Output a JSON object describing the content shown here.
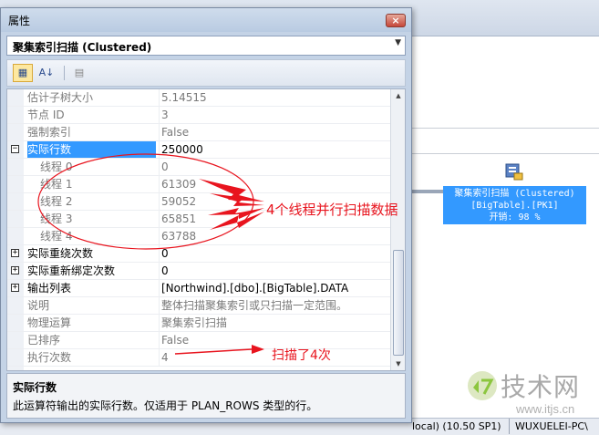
{
  "window": {
    "title": "属性",
    "close_label": "×",
    "object_selector": "聚集索引扫描 (Clustered)"
  },
  "toolbar": {
    "buttons": [
      {
        "name": "categorized-icon",
        "label": "▦"
      },
      {
        "name": "alphabetical-icon",
        "label": "A↓"
      },
      {
        "name": "property-pages-icon",
        "label": "▤"
      }
    ]
  },
  "properties": [
    {
      "name": "估计子树大小",
      "value": "5.14515",
      "readonly": true,
      "expander": "",
      "indent": false
    },
    {
      "name": "节点 ID",
      "value": "3",
      "readonly": true,
      "expander": "",
      "indent": false
    },
    {
      "name": "强制索引",
      "value": "False",
      "readonly": true,
      "expander": "",
      "indent": false
    },
    {
      "name": "实际行数",
      "value": "250000",
      "readonly": false,
      "expander": "−",
      "indent": false,
      "selected": true
    },
    {
      "name": "线程 0",
      "value": "0",
      "readonly": true,
      "expander": "",
      "indent": true
    },
    {
      "name": "线程 1",
      "value": "61309",
      "readonly": true,
      "expander": "",
      "indent": true
    },
    {
      "name": "线程 2",
      "value": "59052",
      "readonly": true,
      "expander": "",
      "indent": true
    },
    {
      "name": "线程 3",
      "value": "65851",
      "readonly": true,
      "expander": "",
      "indent": true
    },
    {
      "name": "线程 4",
      "value": "63788",
      "readonly": true,
      "expander": "",
      "indent": true
    },
    {
      "name": "实际重绕次数",
      "value": "0",
      "readonly": false,
      "expander": "+",
      "indent": false
    },
    {
      "name": "实际重新绑定次数",
      "value": "0",
      "readonly": false,
      "expander": "+",
      "indent": false
    },
    {
      "name": "输出列表",
      "value": "[Northwind].[dbo].[BigTable].DATA",
      "readonly": false,
      "expander": "+",
      "indent": false
    },
    {
      "name": "说明",
      "value": "整体扫描聚集索引或只扫描一定范围。",
      "readonly": true,
      "expander": "",
      "indent": false
    },
    {
      "name": "物理运算",
      "value": "聚集索引扫描",
      "readonly": true,
      "expander": "",
      "indent": false
    },
    {
      "name": "已排序",
      "value": "False",
      "readonly": true,
      "expander": "",
      "indent": false
    },
    {
      "name": "执行次数",
      "value": "4",
      "readonly": true,
      "expander": "",
      "indent": false
    }
  ],
  "help": {
    "title": "实际行数",
    "description": "此运算符输出的实际行数。仅适用于 PLAN_ROWS 类型的行。"
  },
  "plan_node": {
    "line1": "聚集索引扫描 (Clustered)",
    "line2": "[BigTable].[PK1]",
    "line3": "开销: 98 %"
  },
  "status_bar": {
    "server": "local) (10.50 SP1)",
    "user": "WUXUELEI-PC\\"
  },
  "annotations": {
    "threads_note": "4个线程并行扫描数据",
    "exec_note": "扫描了4次"
  },
  "watermark": {
    "brand": "技术网",
    "url": "www.itjs.cn"
  },
  "colors": {
    "selection": "#3399ff",
    "annotation": "#e8141e",
    "plan_node": "#3399ff"
  }
}
